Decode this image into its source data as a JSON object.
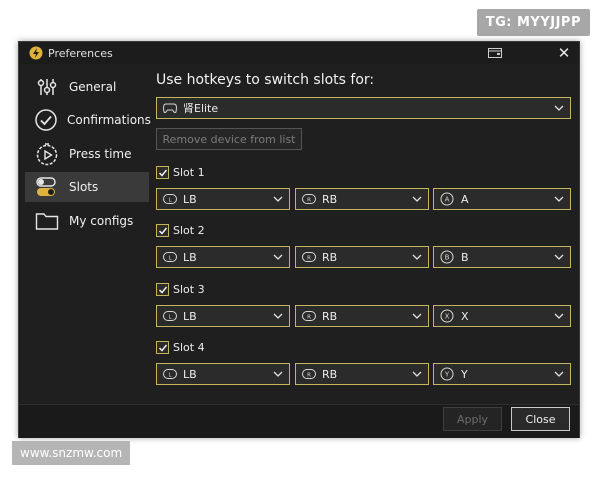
{
  "watermarks": {
    "top": "TG: MYYJJPP",
    "bottom": "www.snzmw.com"
  },
  "window": {
    "title": "Preferences",
    "close_glyph": "✕"
  },
  "sidebar": {
    "items": [
      {
        "label": "General",
        "icon": "sliders-icon"
      },
      {
        "label": "Confirmations",
        "icon": "check-circle-icon"
      },
      {
        "label": "Press time",
        "icon": "timer-icon"
      },
      {
        "label": "Slots",
        "icon": "toggle-icon",
        "active": true
      },
      {
        "label": "My configs",
        "icon": "folder-icon"
      }
    ]
  },
  "main": {
    "heading": "Use hotkeys to switch slots for:",
    "device": {
      "value": "肾Elite",
      "icon": "gamepad-icon"
    },
    "remove_button": "Remove device from list",
    "slots": [
      {
        "label": "Slot 1",
        "checked": true,
        "first": "LB",
        "second": "RB",
        "third": "A"
      },
      {
        "label": "Slot 2",
        "checked": true,
        "first": "LB",
        "second": "RB",
        "third": "B"
      },
      {
        "label": "Slot 3",
        "checked": true,
        "first": "LB",
        "second": "RB",
        "third": "X"
      },
      {
        "label": "Slot 4",
        "checked": true,
        "first": "LB",
        "second": "RB",
        "third": "Y"
      }
    ]
  },
  "footer": {
    "apply": "Apply",
    "close": "Close"
  },
  "colors": {
    "accent": "#c8b45a",
    "window_bg": "#1f1f1f",
    "control_bg": "#2b2b2b",
    "active_nav": "#3a3a3a"
  }
}
